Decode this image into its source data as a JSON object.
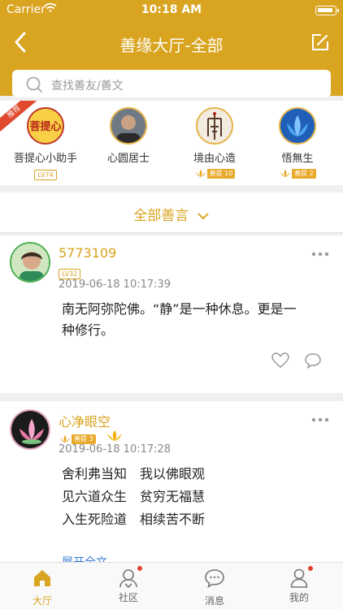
{
  "status_bar": {
    "carrier": "Carrier",
    "time": "10:18 AM"
  },
  "nav": {
    "title": "善缘大厅-全部"
  },
  "search": {
    "placeholder": "查找善友/善文"
  },
  "recommend_tag": "推荐",
  "featured_users": [
    {
      "name": "菩提心小助手",
      "level": "LV74",
      "avatar_text": "菩提心"
    },
    {
      "name": "心圆居士"
    },
    {
      "name": "境由心造",
      "badge": "善提 10"
    },
    {
      "name": "悟無生",
      "badge": "善提 2"
    }
  ],
  "section": {
    "title": "全部善言"
  },
  "posts": [
    {
      "name": "5773109",
      "level": "LV32",
      "time": "2019-06-18 10:17:39",
      "lines": [
        "南无阿弥陀佛。“静”是一种休息。更是一",
        "种修行。"
      ]
    },
    {
      "name": "心净眼空",
      "badge": "善提 3",
      "time": "2019-06-18 10:17:28",
      "lines": [
        "舍利弗当知　我以佛眼观",
        "见六道众生　贫穷无福慧",
        "入生死险道　相续苦不断"
      ],
      "expand": "展开全文"
    }
  ],
  "tabs": [
    {
      "label": "大厅",
      "active": true
    },
    {
      "label": "社区",
      "dot": true
    },
    {
      "label": "消息"
    },
    {
      "label": "我的",
      "dot": true
    }
  ],
  "colors": {
    "accent": "#d9a41f",
    "dot": "#e0402a"
  }
}
